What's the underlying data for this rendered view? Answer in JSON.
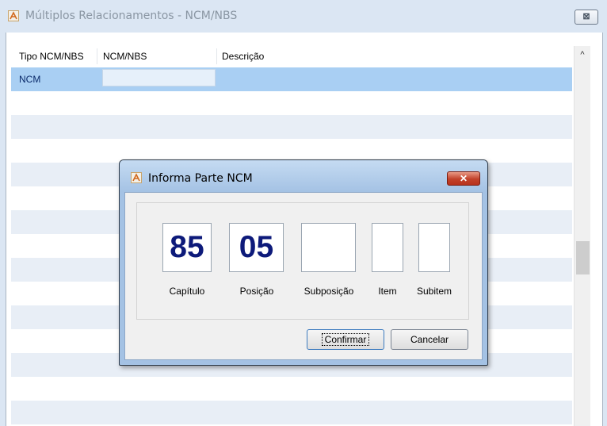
{
  "window": {
    "title": "Múltiplos Relacionamentos - NCM/NBS",
    "close_glyph": "⊠"
  },
  "grid": {
    "columns": [
      "Tipo NCM/NBS",
      "NCM/NBS",
      "Descrição"
    ],
    "rows": [
      {
        "tipo": "NCM",
        "ncm_nbs": "",
        "descricao": ""
      }
    ],
    "scroll_up_glyph": "^"
  },
  "dialog": {
    "title": "Informa Parte NCM",
    "close_glyph": "✕",
    "fields": [
      {
        "label": "Capítulo",
        "value": "85"
      },
      {
        "label": "Posição",
        "value": "05"
      },
      {
        "label": "Subposição",
        "value": ""
      },
      {
        "label": "Item",
        "value": ""
      },
      {
        "label": "Subitem",
        "value": ""
      }
    ],
    "confirm_label": "Confirmar",
    "cancel_label": "Cancelar"
  }
}
